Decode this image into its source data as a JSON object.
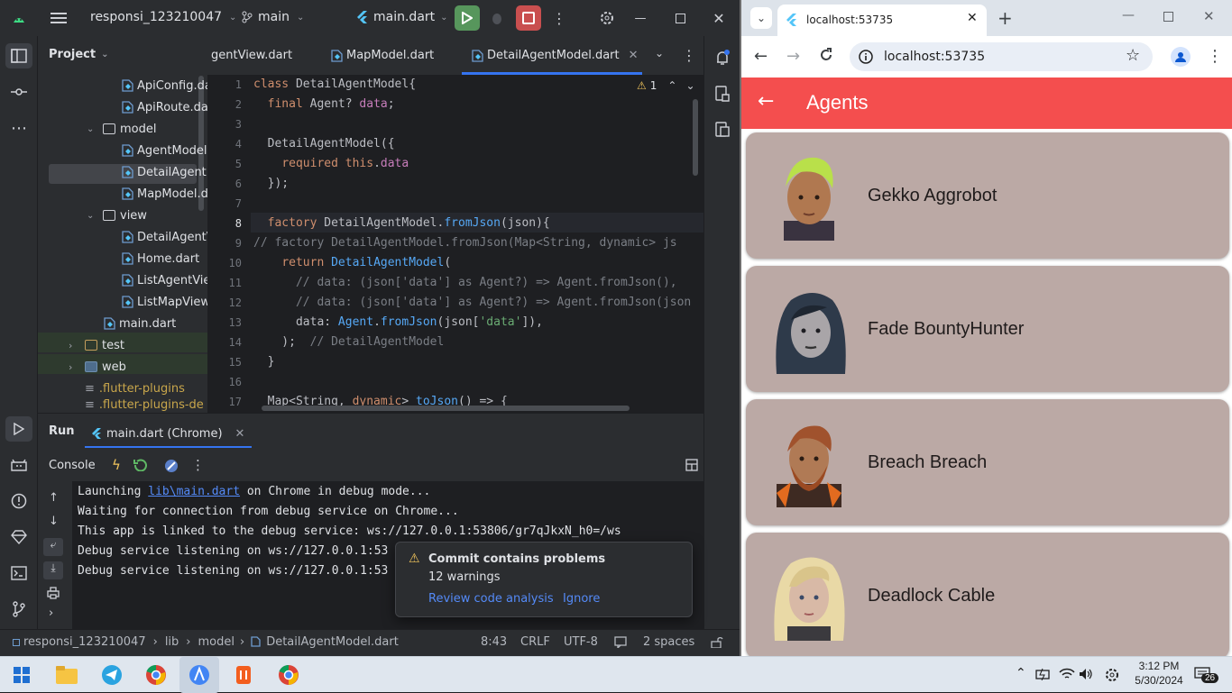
{
  "ide": {
    "project_name": "responsi_123210047",
    "branch": "main",
    "run_config": "main.dart",
    "project_label": "Project",
    "tree": [
      {
        "label": "ApiConfig.da",
        "kind": "dart"
      },
      {
        "label": "ApiRoute.dar",
        "kind": "dart"
      },
      {
        "label": "model",
        "kind": "folder"
      },
      {
        "label": "AgentModel",
        "kind": "dart"
      },
      {
        "label": "DetailAgentM",
        "kind": "dart"
      },
      {
        "label": "MapModel.d",
        "kind": "dart"
      },
      {
        "label": "view",
        "kind": "folder"
      },
      {
        "label": "DetailAgentV",
        "kind": "dart"
      },
      {
        "label": "Home.dart",
        "kind": "dart"
      },
      {
        "label": "ListAgentVie",
        "kind": "dart"
      },
      {
        "label": "ListMapView",
        "kind": "dart"
      },
      {
        "label": "main.dart",
        "kind": "dart"
      },
      {
        "label": "test",
        "kind": "folder"
      },
      {
        "label": "web",
        "kind": "folder"
      },
      {
        "label": ".flutter-plugins",
        "kind": "file"
      },
      {
        "label": ".flutter-plugins-de",
        "kind": "file"
      }
    ],
    "tabs": [
      "gentView.dart",
      "MapModel.dart",
      "DetailAgentModel.dart"
    ],
    "warning_count": "1",
    "line_numbers": [
      "1",
      "2",
      "3",
      "4",
      "5",
      "6",
      "7",
      "8",
      "9",
      "10",
      "11",
      "12",
      "13",
      "14",
      "15",
      "16",
      "17"
    ],
    "run": {
      "tab_run": "Run",
      "tab_config": "main.dart (Chrome)",
      "console_label": "Console",
      "lines": [
        [
          "Launching ",
          "lib\\main.dart",
          " on Chrome in debug mode..."
        ],
        "Waiting for connection from debug service on Chrome...",
        "This app is linked to the debug service: ws://127.0.0.1:53806/gr7qJkxN_h0=/ws",
        "Debug service listening on ws://127.0.0.1:53",
        "Debug service listening on ws://127.0.0.1:53"
      ]
    },
    "notification": {
      "title": "Commit contains problems",
      "subtitle": "12 warnings",
      "action_primary": "Review code analysis",
      "action_secondary": "Ignore"
    },
    "status": {
      "breadcrumb": [
        "responsi_123210047",
        "lib",
        "model",
        "DetailAgentModel.dart"
      ],
      "position": "8:43",
      "line_sep": "CRLF",
      "encoding": "UTF-8",
      "indent": "2 spaces"
    }
  },
  "browser": {
    "tab_title": "localhost:53735",
    "url": "localhost:53735",
    "app_title": "Agents",
    "agents": [
      {
        "name": "Gekko Aggrobot",
        "hair": "#b9e04a",
        "skin": "#b07850"
      },
      {
        "name": "Fade BountyHunter",
        "hair": "#2e3a4a",
        "skin": "#a9a5a8"
      },
      {
        "name": "Breach Breach",
        "hair": "#a0522d",
        "skin": "#b07a55"
      },
      {
        "name": "Deadlock Cable",
        "hair": "#e9d9a6",
        "skin": "#d8b9a6"
      }
    ],
    "colors": {
      "appbar": "#f44e4e",
      "card": "#bba9a5"
    }
  },
  "taskbar": {
    "time": "3:12 PM",
    "date": "5/30/2024",
    "notifications": "26"
  }
}
